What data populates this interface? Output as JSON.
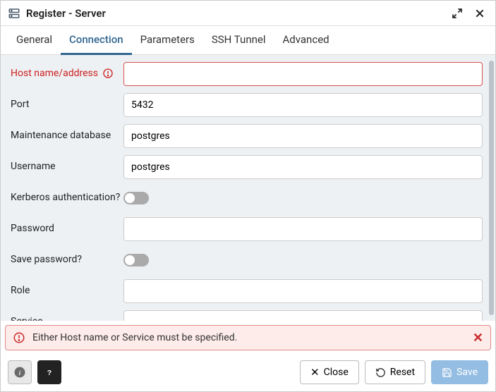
{
  "header": {
    "title": "Register - Server"
  },
  "tabs": [
    {
      "label": "General",
      "active": false
    },
    {
      "label": "Connection",
      "active": true
    },
    {
      "label": "Parameters",
      "active": false
    },
    {
      "label": "SSH Tunnel",
      "active": false
    },
    {
      "label": "Advanced",
      "active": false
    }
  ],
  "form": {
    "host": {
      "label": "Host name/address",
      "value": ""
    },
    "port": {
      "label": "Port",
      "value": "5432"
    },
    "maintenance_db": {
      "label": "Maintenance database",
      "value": "postgres"
    },
    "username": {
      "label": "Username",
      "value": "postgres"
    },
    "kerberos": {
      "label": "Kerberos authentication?",
      "value": false
    },
    "password": {
      "label": "Password",
      "value": ""
    },
    "save_password": {
      "label": "Save password?",
      "value": false
    },
    "role": {
      "label": "Role",
      "value": ""
    },
    "service": {
      "label": "Service",
      "value": ""
    }
  },
  "error": {
    "message": "Either Host name or Service must be specified."
  },
  "footer": {
    "close": "Close",
    "reset": "Reset",
    "save": "Save"
  }
}
